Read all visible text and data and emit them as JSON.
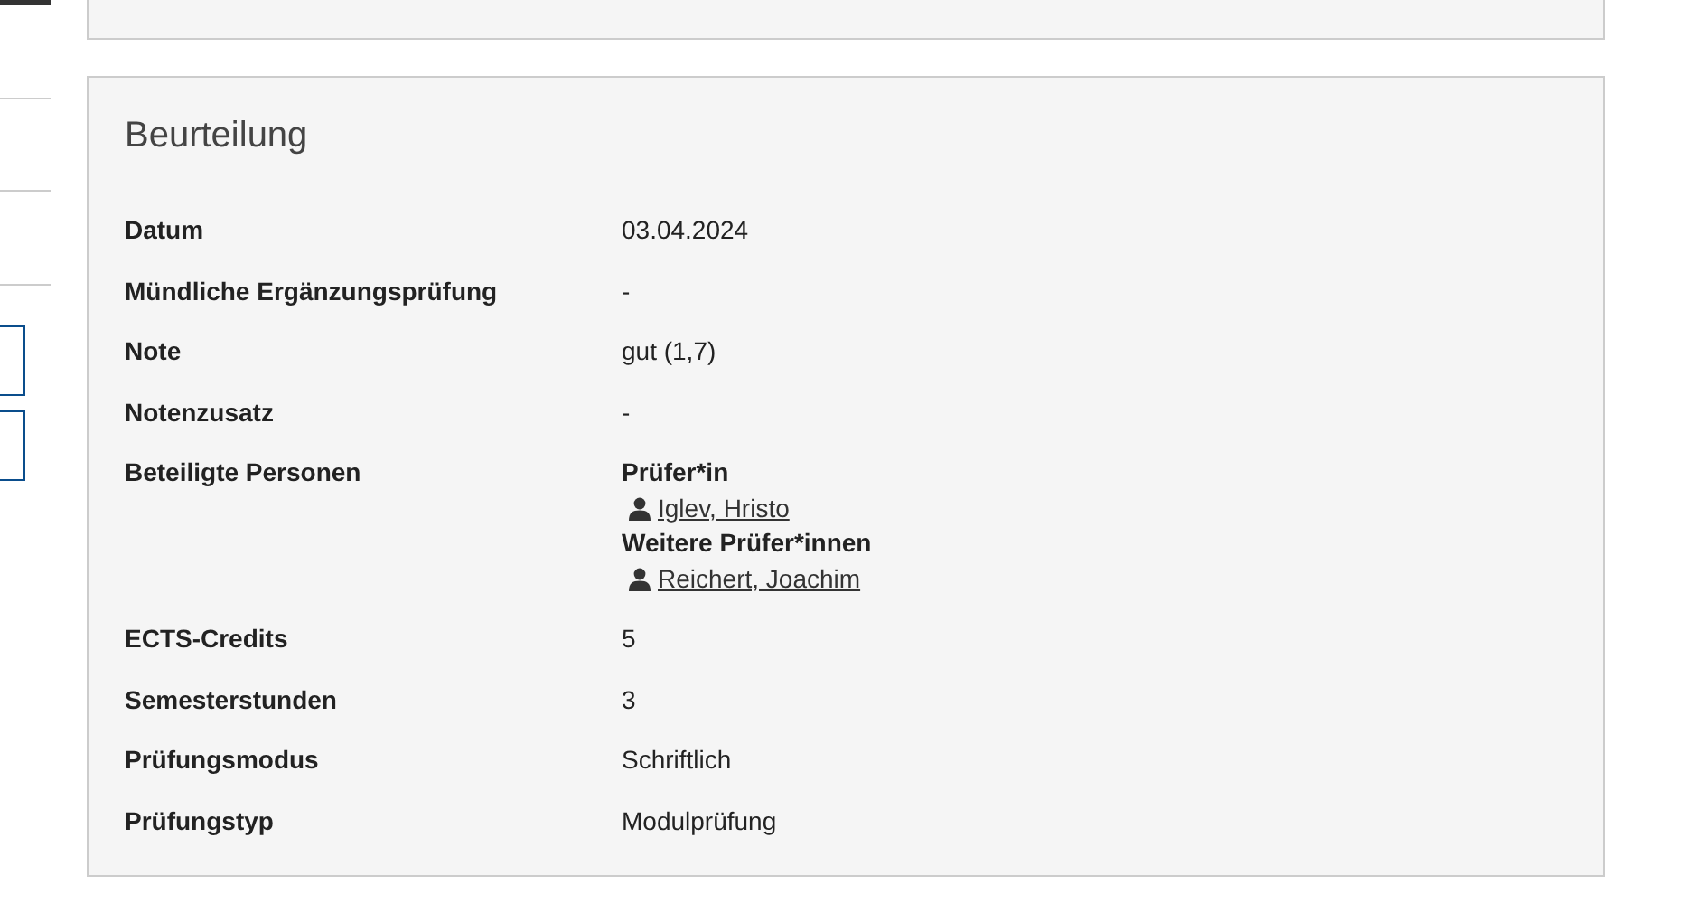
{
  "section": {
    "title": "Beurteilung",
    "rows": [
      {
        "kind": "text",
        "label": "Datum",
        "value": "03.04.2024"
      },
      {
        "kind": "text",
        "label": "Mündliche Ergänzungsprüfung",
        "value": "-"
      },
      {
        "kind": "text",
        "label": "Note",
        "value": "gut (1,7)"
      },
      {
        "kind": "text",
        "label": "Notenzusatz",
        "value": "-"
      },
      {
        "kind": "persons",
        "label": "Beteiligte Personen",
        "groups": [
          {
            "heading": "Prüfer*in",
            "persons": [
              "Iglev, Hristo"
            ]
          },
          {
            "heading": "Weitere Prüfer*innen",
            "persons": [
              "Reichert, Joachim"
            ]
          }
        ]
      },
      {
        "kind": "text",
        "label": "ECTS-Credits",
        "value": "5"
      },
      {
        "kind": "text",
        "label": "Semesterstunden",
        "value": "3"
      },
      {
        "kind": "text",
        "label": "Prüfungsmodus",
        "value": "Schriftlich"
      },
      {
        "kind": "text",
        "label": "Prüfungstyp",
        "value": "Modulprüfung"
      }
    ]
  }
}
